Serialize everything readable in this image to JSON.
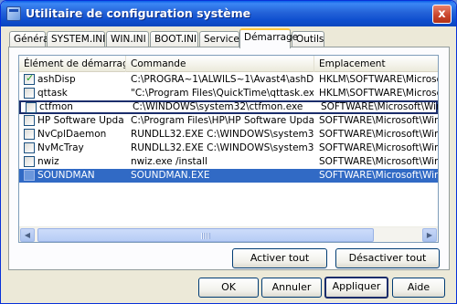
{
  "window": {
    "title": "Utilitaire de configuration système",
    "close_label": "x"
  },
  "tabs": [
    {
      "label": "Général"
    },
    {
      "label": "SYSTEM.INI"
    },
    {
      "label": "WIN.INI"
    },
    {
      "label": "BOOT.INI"
    },
    {
      "label": "Services"
    },
    {
      "label": "Démarrage",
      "active": true
    },
    {
      "label": "Outils"
    }
  ],
  "startup_list": {
    "columns": [
      "Élément de démarrage",
      "Commande",
      "Emplacement"
    ],
    "rows": [
      {
        "checked": true,
        "item": "ashDisp",
        "command": "C:\\PROGRA~1\\ALWILS~1\\Avast4\\ashDisp....",
        "location": "HKLM\\SOFTWARE\\Microsoft\\Wi"
      },
      {
        "checked": false,
        "item": "qttask",
        "command": "\"C:\\Program Files\\QuickTime\\qttask.exe\" -at...",
        "location": "HKLM\\SOFTWARE\\Microsoft\\Wi"
      },
      {
        "checked": false,
        "item": "ctfmon",
        "command": "C:\\WINDOWS\\system32\\ctfmon.exe",
        "location": "SOFTWARE\\Microsoft\\Windows\\",
        "focused": true
      },
      {
        "checked": false,
        "item": "HP Software Update",
        "command": "C:\\Program Files\\HP\\HP Software Update\\H...",
        "location": "SOFTWARE\\Microsoft\\Windows\\"
      },
      {
        "checked": false,
        "item": "NvCplDaemon",
        "command": "RUNDLL32.EXE C:\\WINDOWS\\system32\\Nv...",
        "location": "SOFTWARE\\Microsoft\\Windows\\"
      },
      {
        "checked": false,
        "item": "NvMcTray",
        "command": "RUNDLL32.EXE C:\\WINDOWS\\system32\\Nv...",
        "location": "SOFTWARE\\Microsoft\\Windows\\"
      },
      {
        "checked": false,
        "item": "nwiz",
        "command": "nwiz.exe /install",
        "location": "SOFTWARE\\Microsoft\\Windows\\"
      },
      {
        "checked": false,
        "item": "SOUNDMAN",
        "command": "SOUNDMAN.EXE",
        "location": "SOFTWARE\\Microsoft\\Windows\\",
        "selected": true
      }
    ]
  },
  "panel_buttons": {
    "enable_all": "Activer tout",
    "disable_all": "Désactiver tout"
  },
  "dialog_buttons": {
    "ok": "OK",
    "cancel": "Annuler",
    "apply": "Appliquer",
    "help": "Aide"
  },
  "colors": {
    "selection": "#316ac5",
    "titlebar": "#0b4fcf",
    "focus_border": "#1b2d6b"
  }
}
